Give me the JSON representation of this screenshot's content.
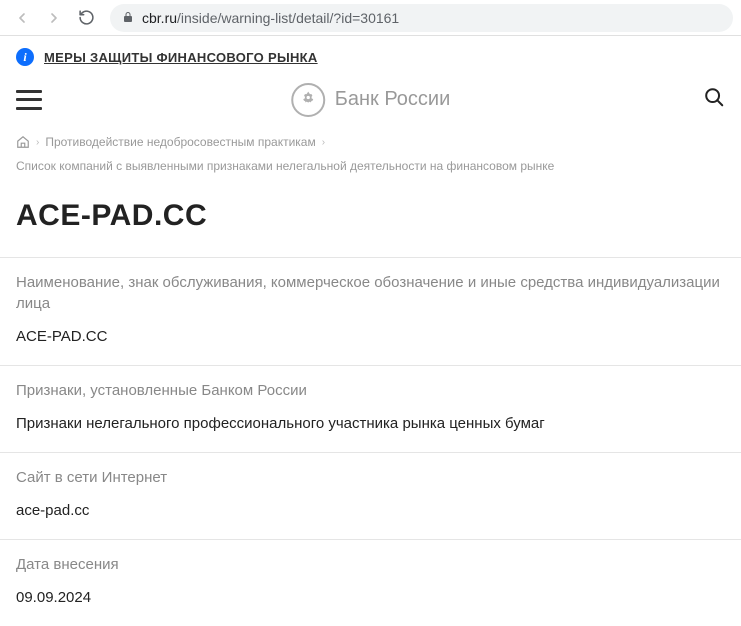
{
  "browser": {
    "url_domain": "cbr.ru",
    "url_path": "/inside/warning-list/detail/?id=30161"
  },
  "banner": {
    "text": "МЕРЫ ЗАЩИТЫ ФИНАНСОВОГО РЫНКА"
  },
  "header": {
    "site_name": "Банк России"
  },
  "breadcrumbs": {
    "item1": "Противодействие недобросовестным практикам",
    "item2": "Список компаний с выявленными признаками нелегальной деятельности на финансовом рынке"
  },
  "title": "ACE-PAD.CC",
  "sections": [
    {
      "label": "Наименование, знак обслуживания, коммерческое обозначение и иные средства индивидуализации лица",
      "value": "ACE-PAD.CC"
    },
    {
      "label": "Признаки, установленные Банком России",
      "value": "Признаки нелегального профессионального участника рынка ценных бумаг"
    },
    {
      "label": "Сайт в сети Интернет",
      "value": "ace-pad.cc"
    },
    {
      "label": "Дата внесения",
      "value": "09.09.2024"
    }
  ]
}
